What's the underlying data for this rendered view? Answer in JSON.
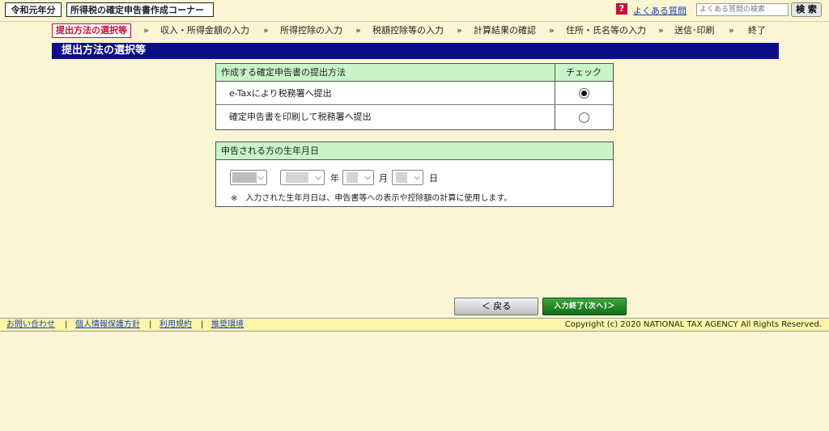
{
  "header": {
    "year_badge": "令和元年分",
    "corner_title": "所得税の確定申告書作成コーナー",
    "help_icon": "question-icon",
    "faq_link": "よくある質問",
    "search_placeholder": "よくある質問の検索",
    "search_button": "検 索"
  },
  "steps": [
    "提出方法の選択等",
    "収入・所得金額の入力",
    "所得控除の入力",
    "税額控除等の入力",
    "計算結果の確認",
    "住所・氏名等の入力",
    "送信･印刷",
    "終了"
  ],
  "step_separator": "»",
  "page_title": "提出方法の選択等",
  "method_table": {
    "header_label": "作成する確定申告書の提出方法",
    "header_check": "チェック",
    "options": [
      {
        "label": "e-Taxにより税務署へ提出",
        "selected": true
      },
      {
        "label": "確定申告書を印刷して税務署へ提出",
        "selected": false
      }
    ]
  },
  "birth_table": {
    "header_label": "申告される方の生年月日",
    "era_value": "",
    "year_value": "",
    "month_value": "",
    "day_value": "",
    "unit_year": "年",
    "unit_month": "月",
    "unit_day": "日",
    "note": "※　入力された生年月日は、申告書等への表示や控除額の計算に使用します。"
  },
  "buttons": {
    "back": "＜ 戻る",
    "next": "入力終了(次へ)＞"
  },
  "footer": {
    "links": [
      "お問い合わせ",
      "個人情報保護方針",
      "利用規約",
      "推奨環境"
    ],
    "separator": "|",
    "copyright": "Copyright (c) 2020 NATIONAL TAX AGENCY All Rights Reserved."
  }
}
